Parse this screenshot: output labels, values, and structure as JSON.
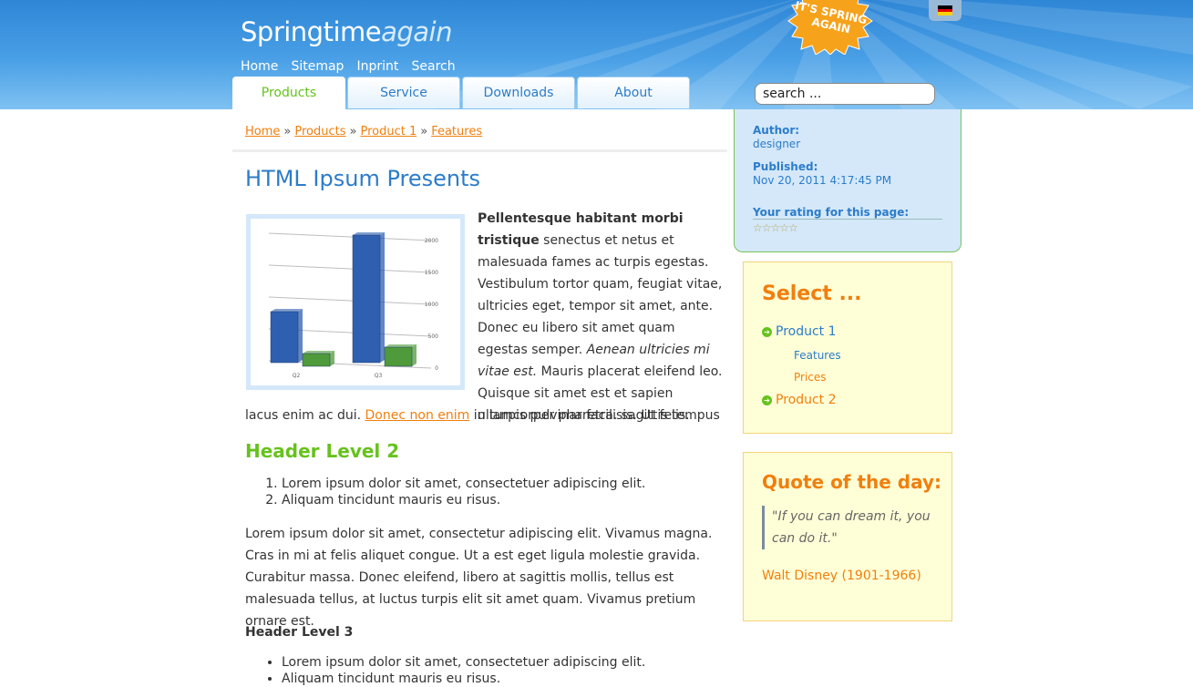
{
  "site": {
    "logo_main": "Springtime",
    "logo_italic": "again",
    "burst_text_1": "IT'S SPRING",
    "burst_text_2": "AGAIN"
  },
  "topnav": [
    "Home",
    "Sitemap",
    "Inprint",
    "Search"
  ],
  "tabs": [
    "Products",
    "Service",
    "Downloads",
    "About"
  ],
  "active_tab": "Products",
  "search": {
    "value": "search ..."
  },
  "breadcrumb": [
    "Home",
    "Products",
    "Product 1",
    "Features"
  ],
  "breadcrumb_sep": "»",
  "main": {
    "title": "HTML Ipsum Presents",
    "p1_bold": "Pellentesque habitant morbi tristique",
    "p1_text": " senectus et netus et malesuada fames ac turpis egestas. Vestibulum tortor quam, feugiat vitae, ultricies eget, tempor sit amet, ante. Donec eu libero sit amet quam egestas semper. ",
    "p1_italic": "Aenean ultricies mi vitae est.",
    "p1_text2": " Mauris placerat eleifend leo. Quisque sit amet est et sapien ullamcorper pharetra. sagittis tempus",
    "p1_last_start": "lacus enim ac dui. ",
    "p1_link": "Donec non enim",
    "p1_last_end": " in turpis pulvinar facilisis. Ut felis.",
    "h2": "Header Level 2",
    "ol": [
      "Lorem ipsum dolor sit amet, consectetuer adipiscing elit.",
      "Aliquam tincidunt mauris eu risus."
    ],
    "p2": "Lorem ipsum dolor sit amet, consectetur adipiscing elit. Vivamus magna. Cras in mi at felis aliquet congue. Ut a est eget ligula molestie gravida. Curabitur massa. Donec eleifend, libero at sagittis mollis, tellus est malesuada tellus, at luctus turpis elit sit amet quam. Vivamus pretium ornare est.",
    "h3": "Header Level 3",
    "ul": [
      "Lorem ipsum dolor sit amet, consectetuer adipiscing elit.",
      "Aliquam tincidunt mauris eu risus."
    ]
  },
  "chart_data": {
    "type": "bar",
    "categories": [
      "Q2",
      "Q3"
    ],
    "series": [
      {
        "values": [
          800,
          2000
        ],
        "color": "#2f5fb0"
      },
      {
        "values": [
          200,
          300
        ],
        "color": "#4f9a3a"
      }
    ],
    "yticks": [
      "2000",
      "1500",
      "1000",
      "500",
      "0"
    ],
    "ylim": [
      0,
      2000
    ]
  },
  "info": {
    "author_label": "Author:",
    "author": "designer",
    "published_label": "Published:",
    "published": "Nov 20, 2011 4:17:45 PM",
    "rating_label": "Your rating for this page:",
    "rating_stars": "☆☆☆☆☆"
  },
  "select": {
    "heading": "Select ...",
    "items": [
      {
        "label": "Product 1",
        "sub": [
          "Features",
          "Prices"
        ]
      },
      {
        "label": "Product 2"
      }
    ]
  },
  "quote": {
    "heading": "Quote of the day:",
    "text": "\"If you can dream it, you can do it.\"",
    "author": "Walt Disney (1901-1966)"
  },
  "colors": {
    "accent_blue": "#2c7cc9",
    "accent_orange": "#f07f0f",
    "accent_green": "#66c21d"
  }
}
